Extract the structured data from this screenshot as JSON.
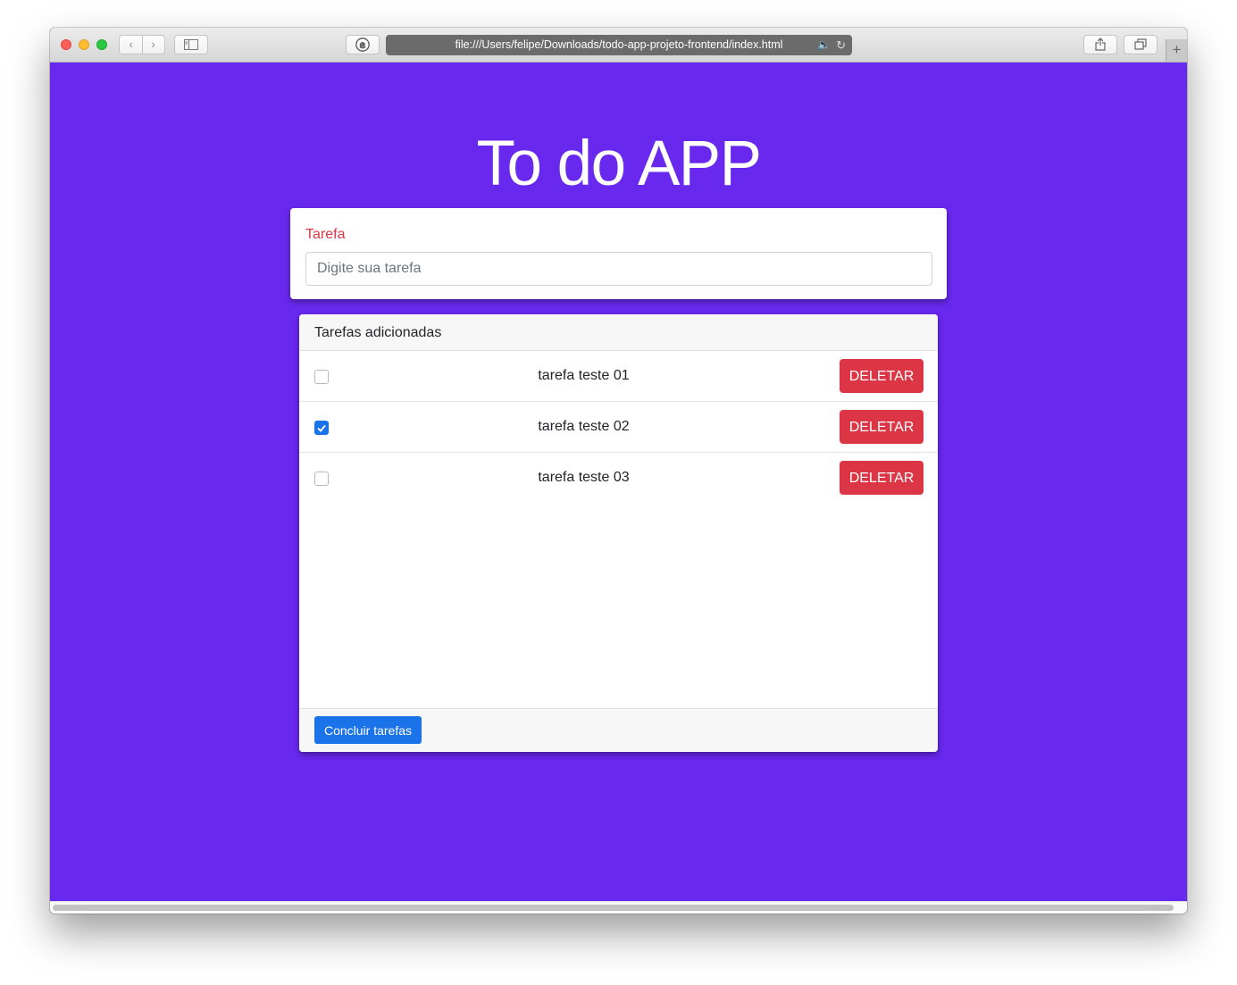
{
  "browser": {
    "url": "file:///Users/felipe/Downloads/todo-app-projeto-frontend/index.html",
    "icons": {
      "back": "chevron-left-icon",
      "forward": "chevron-right-icon",
      "sidebar": "sidebar-icon",
      "privacy": "hand-icon",
      "audio": "speaker-icon",
      "reload": "reload-icon",
      "share": "share-icon",
      "tabs": "tabs-icon",
      "new_tab": "plus-icon"
    }
  },
  "app": {
    "title": "To do APP",
    "form": {
      "label": "Tarefa",
      "input_placeholder": "Digite sua tarefa",
      "input_value": ""
    },
    "list": {
      "header": "Tarefas adicionadas",
      "tasks": [
        {
          "text": "tarefa teste 01",
          "done": false,
          "delete_label": "DELETAR"
        },
        {
          "text": "tarefa teste 02",
          "done": true,
          "delete_label": "DELETAR"
        },
        {
          "text": "tarefa teste 03",
          "done": false,
          "delete_label": "DELETAR"
        }
      ],
      "complete_button": "Concluir tarefas"
    },
    "colors": {
      "background": "#6928ee",
      "label": "#dc3545",
      "delete": "#dc3545",
      "primary": "#1a73e8"
    }
  }
}
